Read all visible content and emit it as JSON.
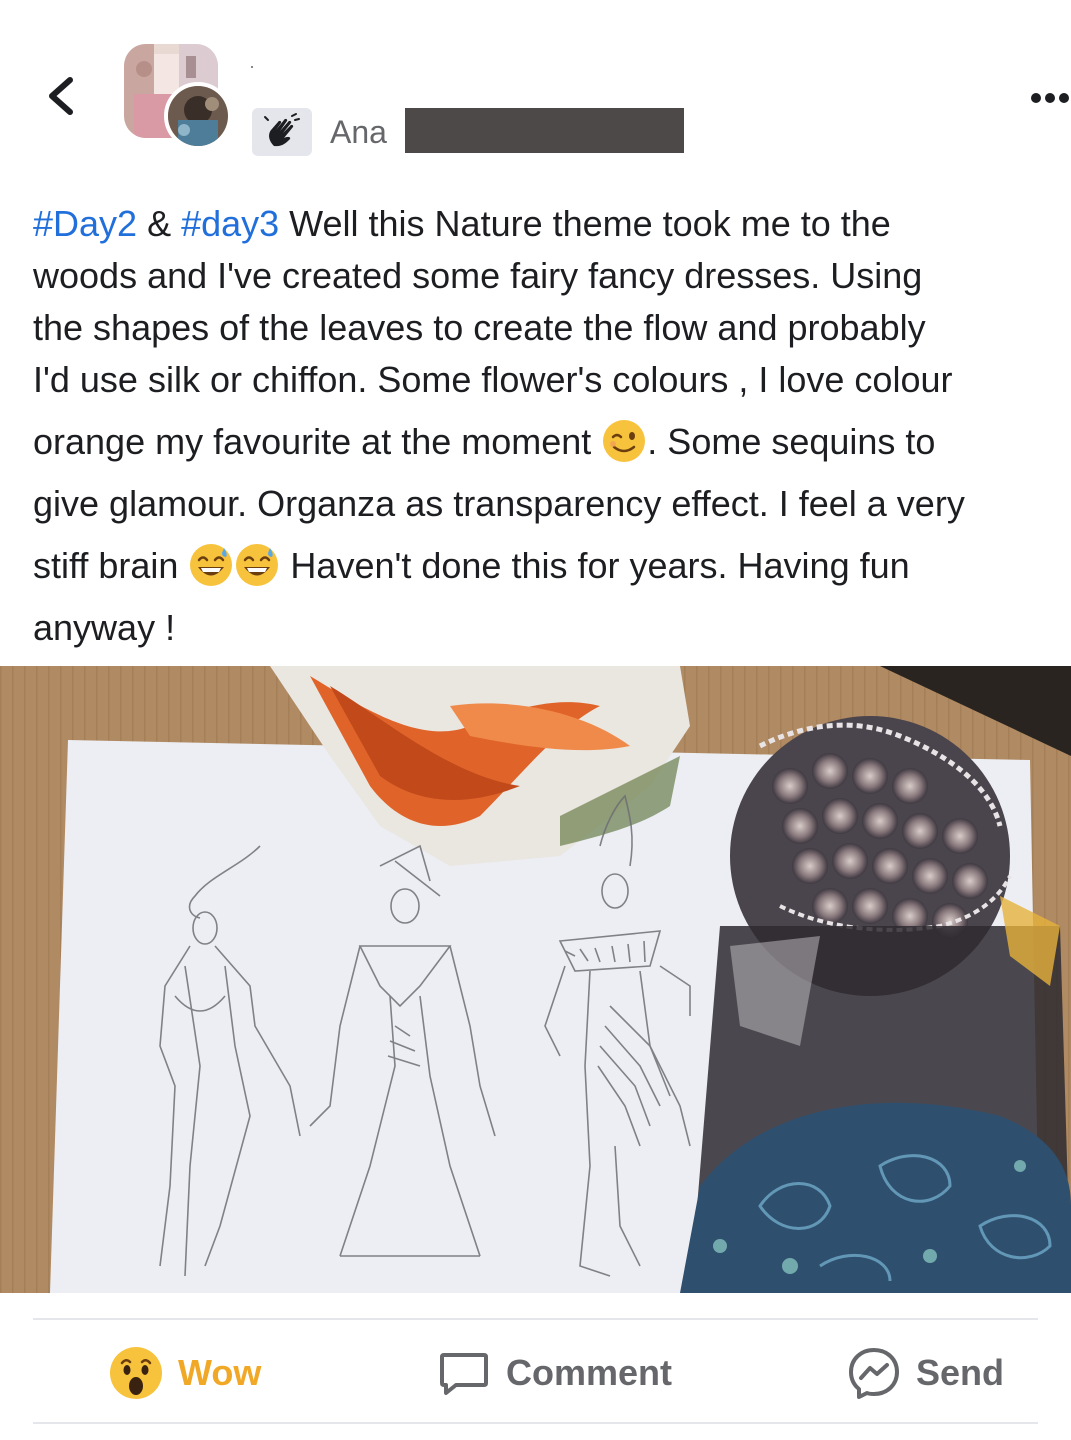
{
  "header": {
    "author_name": "Ana",
    "back_icon": "chevron-left-icon",
    "more_icon": "more-dots-icon",
    "badge_icon": "waving-hand-icon"
  },
  "post": {
    "lines": [
      {
        "tag1": "#Day2",
        "mid": " & ",
        "tag2": "#day3",
        "rest": " Well this Nature theme took me to the"
      },
      {
        "text": "woods and I've created some fairy fancy dresses. Using"
      },
      {
        "text": "the shapes of the leaves to create the flow and probably"
      },
      {
        "text": "I'd use silk or chiffon. Some flower's colours ,  I love colour"
      },
      {
        "before": "orange my favourite at the moment ",
        "after": ". Some sequins to"
      },
      {
        "text": "give glamour.  Organza as transparency effect. I feel a very"
      },
      {
        "before": "stiff brain ",
        "after": " Haven't done this for years. Having fun"
      },
      {
        "text": "anyway !"
      }
    ],
    "emojis": [
      "winking-face",
      "grinning-sweat-face",
      "grinning-sweat-face"
    ]
  },
  "photo": {
    "description_icon": "post-photo"
  },
  "actions": {
    "wow_label": "Wow",
    "comment_label": "Comment",
    "send_label": "Send",
    "wow_color": "#f0a826",
    "hashtag_color": "#216fdb"
  }
}
